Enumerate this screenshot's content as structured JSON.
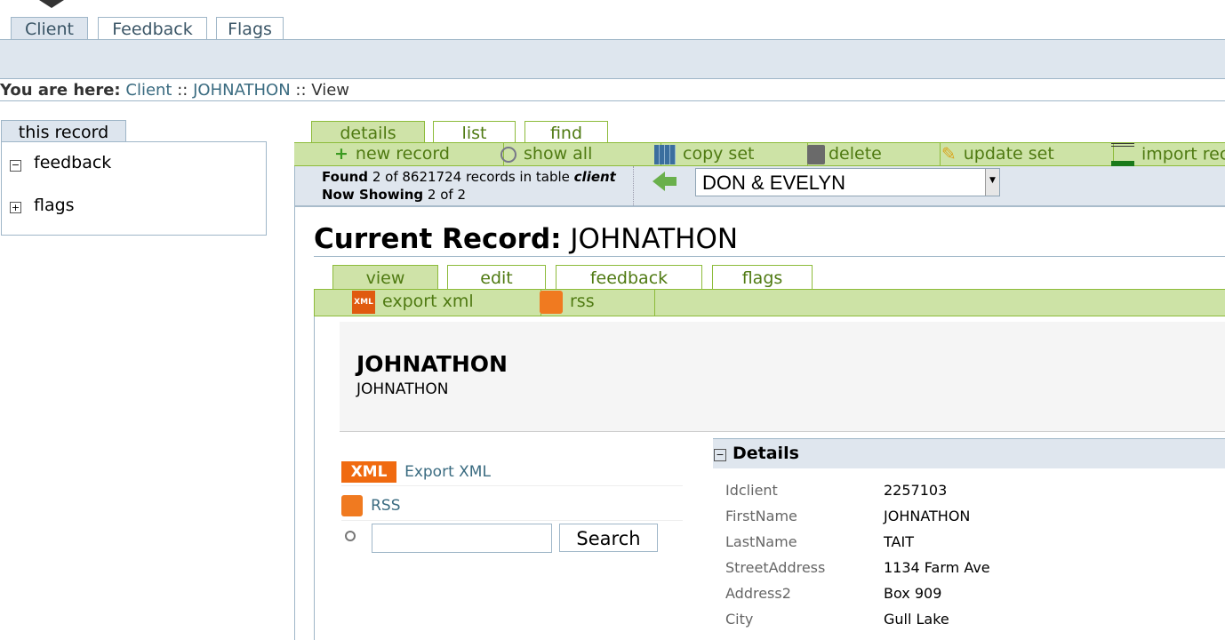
{
  "top_tabs": [
    "Client",
    "Feedback",
    "Flags"
  ],
  "breadcrumb": {
    "prefix": "You are here:",
    "items": [
      "Client",
      "JOHNATHON",
      "View"
    ],
    "sep": "::"
  },
  "sidebar": {
    "tab": "this record",
    "items": [
      {
        "label": "feedback",
        "state": "expanded"
      },
      {
        "label": "flags",
        "state": "collapsed"
      }
    ]
  },
  "main_tabs": [
    "details",
    "list",
    "find"
  ],
  "toolbar": [
    {
      "label": "new record",
      "icon": "plus-icon"
    },
    {
      "label": "show all",
      "icon": "magnifier-icon"
    },
    {
      "label": "copy set",
      "icon": "table-icon"
    },
    {
      "label": "delete",
      "icon": "trash-icon"
    },
    {
      "label": "update set",
      "icon": "pencil-icon"
    },
    {
      "label": "import rec",
      "icon": "import-icon"
    }
  ],
  "info": {
    "found_label": "Found",
    "found_text": "2 of 8621724 records in table",
    "table": "client",
    "showing_label": "Now Showing",
    "showing_text": "2 of 2",
    "select_value": "DON & EVELYN"
  },
  "record": {
    "title_label": "Current Record:",
    "title_value": "JOHNATHON",
    "heading": "JOHNATHON",
    "subheading": "JOHNATHON"
  },
  "sub_tabs": [
    "view",
    "edit",
    "feedback",
    "flags"
  ],
  "sub_toolbar": [
    {
      "label": "export xml",
      "icon": "xml-icon"
    },
    {
      "label": "rss",
      "icon": "rss-icon"
    }
  ],
  "links": {
    "xml_badge": "XML",
    "export_xml": "Export XML",
    "rss": "RSS",
    "search_button": "Search",
    "search_value": ""
  },
  "details": {
    "title": "Details",
    "rows": [
      [
        "Idclient",
        "2257103"
      ],
      [
        "FirstName",
        "JOHNATHON"
      ],
      [
        "LastName",
        "TAIT"
      ],
      [
        "StreetAddress",
        "1134 Farm Ave"
      ],
      [
        "Address2",
        "Box 909"
      ],
      [
        "City",
        "Gull Lake"
      ]
    ]
  },
  "colors": {
    "green": "#cde3a6",
    "blue_band": "#dee6ee",
    "link": "#3a6b80"
  }
}
